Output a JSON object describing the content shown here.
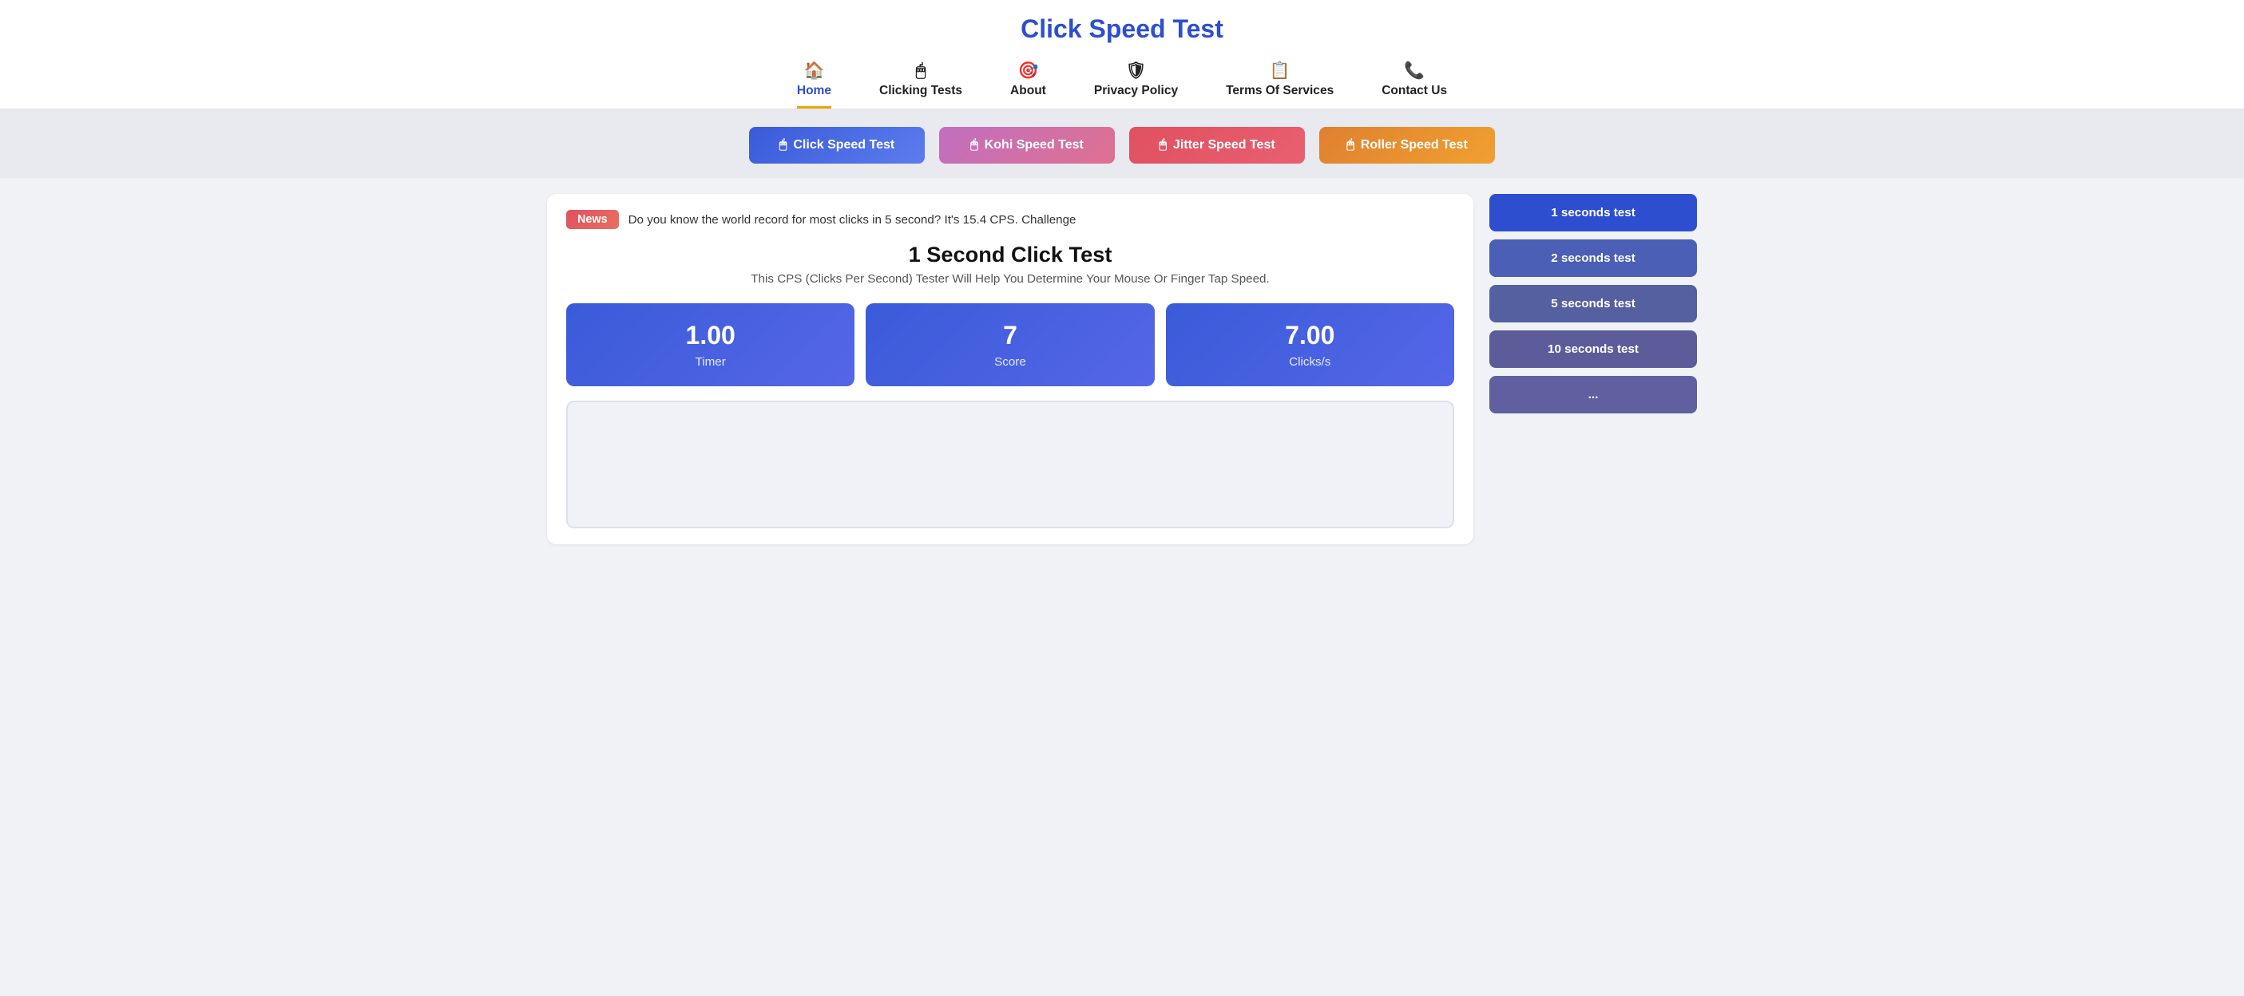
{
  "header": {
    "title": "Click Speed Test",
    "nav": [
      {
        "id": "home",
        "label": "Home",
        "icon": "🏠",
        "active": true
      },
      {
        "id": "clicking",
        "label": "Clicking Tests",
        "icon": "🖱",
        "active": false
      },
      {
        "id": "about",
        "label": "About",
        "icon": "🎯",
        "active": false
      },
      {
        "id": "privacy",
        "label": "Privacy Policy",
        "icon": "🛡",
        "active": false
      },
      {
        "id": "terms",
        "label": "Terms Of Services",
        "icon": "📋",
        "active": false
      },
      {
        "id": "contact",
        "label": "Contact Us",
        "icon": "📞",
        "active": false
      }
    ]
  },
  "speedButtons": [
    {
      "id": "click",
      "label": "Click Speed Test",
      "class": "click"
    },
    {
      "id": "kohi",
      "label": "Kohi Speed Test",
      "class": "kohi"
    },
    {
      "id": "jitter",
      "label": "Jitter Speed Test",
      "class": "jitter"
    },
    {
      "id": "roller",
      "label": "Roller Speed Test",
      "class": "roller"
    }
  ],
  "news": {
    "badge": "News",
    "text": "Do you know the world record for most clicks in 5 second? It's 15.4 CPS. Challenge"
  },
  "testSection": {
    "title": "1 Second Click Test",
    "subtitle": "This CPS (Clicks Per Second) Tester Will Help You Determine Your Mouse Or Finger Tap Speed.",
    "stats": [
      {
        "value": "1.00",
        "label": "Timer"
      },
      {
        "value": "7",
        "label": "Score"
      },
      {
        "value": "7.00",
        "label": "Clicks/s"
      }
    ]
  },
  "durationButtons": [
    {
      "id": "d1",
      "label": "1 seconds test",
      "class": "duration-1"
    },
    {
      "id": "d2",
      "label": "2 seconds test",
      "class": "duration-2"
    },
    {
      "id": "d5",
      "label": "5 seconds test",
      "class": "duration-5"
    },
    {
      "id": "d10",
      "label": "10 seconds test",
      "class": "duration-10"
    },
    {
      "id": "dmore",
      "label": "...",
      "class": "duration-more"
    }
  ]
}
